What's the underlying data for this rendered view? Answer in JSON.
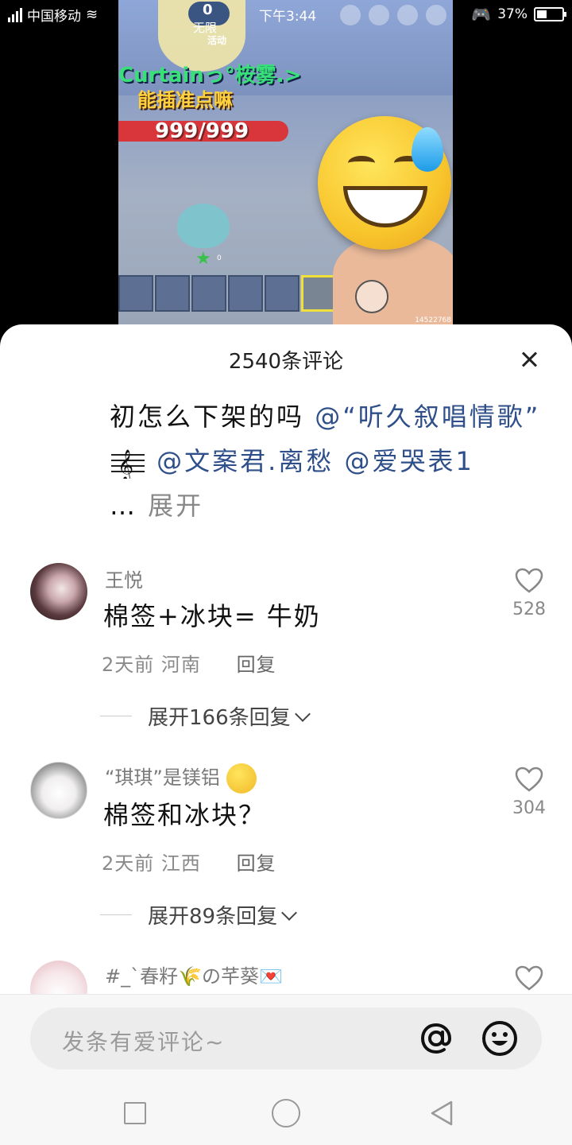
{
  "status_bar": {
    "carrier": "中国移动",
    "time": "下午3:44",
    "battery": "37%"
  },
  "video": {
    "limit_count": "0",
    "limit_label": "无限",
    "activity_label": "活动",
    "player_name": "Curtainっ°桉雾.>",
    "player_sub": "能插准点嘛",
    "hp": "999/999",
    "star_count": "0",
    "video_id": "14522768"
  },
  "sheet": {
    "title": "2540条评论",
    "caption": {
      "text": "初怎么下架的吗 ",
      "mention1": "@“听久叙唱情歌”",
      "mention2": "@文案君.离愁",
      "mention3": "@爱哭表1",
      "ellipsis": "… ",
      "expand": "展开"
    },
    "comments": [
      {
        "name": "王悦",
        "text": "棉签+冰块= 牛奶",
        "time": "2天前",
        "location": "河南",
        "reply": "回复",
        "likes": "528",
        "expand": "展开166条回复"
      },
      {
        "name": "“琪琪”是镁铝",
        "text": "棉签和冰块？",
        "time": "2天前",
        "location": "江西",
        "reply": "回复",
        "likes": "304",
        "expand": "展开89条回复"
      },
      {
        "name": "#_`春籽🌾の芊葵💌"
      }
    ]
  },
  "input": {
    "placeholder": "发条有爱评论~"
  },
  "colors": {
    "mention": "#2f4f8a",
    "hp_bar": "#d8363b",
    "sheet_bg": "#ffffff"
  }
}
